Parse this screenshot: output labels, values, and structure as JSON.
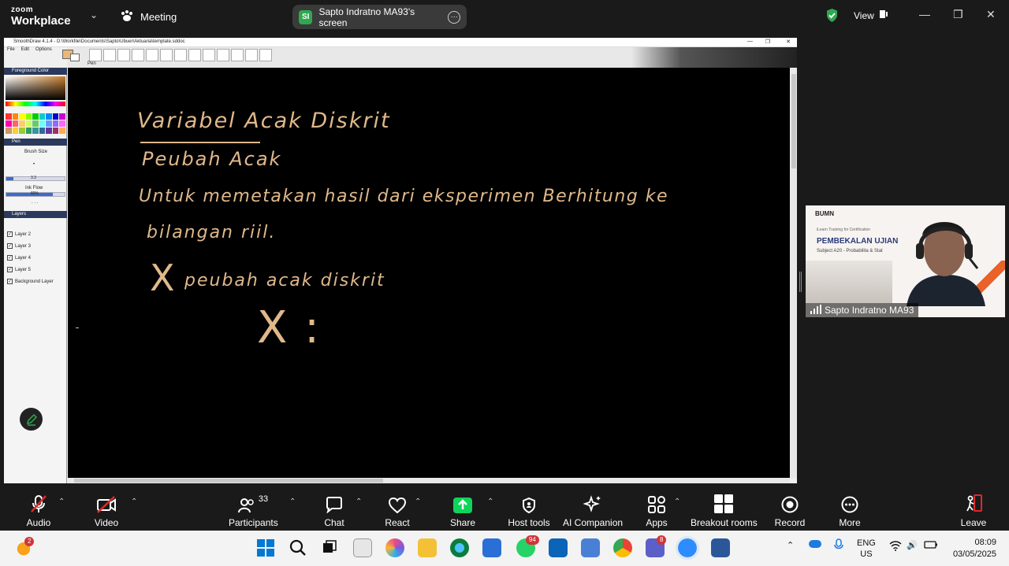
{
  "topbar": {
    "logo_top": "zoom",
    "logo_bottom": "Workplace",
    "meeting_label": "Meeting",
    "share_initials": "SI",
    "share_label": "Sapto Indratno MA93's screen",
    "view_label": "View"
  },
  "smoothdraw": {
    "title": "SmoothDraw 4.1.4 - D:\\Workfile\\Documents\\Sapto\\Ubuer\\Aktuaria\\template.sddoc",
    "menu": [
      "File",
      "Edit",
      "Options"
    ],
    "tool_label": "Pen",
    "panel_foreground": "Foreground Color",
    "panel_pen": "Pen",
    "brush_size_label": "Brush Size",
    "brush_size_value": "3.3",
    "brush_size_fraction": 0.12,
    "ink_flow_label": "Ink Flow",
    "ink_flow_value": "80%",
    "ink_flow_fraction": 0.8,
    "panel_layers": "Layers",
    "layers": [
      "Layer 2",
      "Layer 3",
      "Layer 4",
      "Layer 5",
      "Background Layer"
    ]
  },
  "handwriting": {
    "title": "Variabel Acak Diskrit",
    "subtitle": "Peubah Acak",
    "line1": "Untuk memetakan hasil dari eksperimen Berhitung ke",
    "line2": "bilangan riil.",
    "x_label": "X",
    "x_text": "peubah acak diskrit",
    "x2": "X :"
  },
  "video": {
    "brand": "BUMN",
    "small": "iLearn Training for Certification",
    "title": "PEMBEKALAN UJIAN",
    "subtitle": "Subject A20 - Probabilita & Stat",
    "name": "Sapto Indratno MA93"
  },
  "controls": {
    "audio": "Audio",
    "video": "Video",
    "participants": "Participants",
    "participants_count": "33",
    "chat": "Chat",
    "react": "React",
    "share": "Share",
    "host_tools": "Host tools",
    "ai_companion": "AI Companion",
    "apps": "Apps",
    "breakout": "Breakout rooms",
    "record": "Record",
    "more": "More",
    "leave": "Leave"
  },
  "taskbar": {
    "weather_badge": "2",
    "whatsapp_badge": "94",
    "teams_badge": "8",
    "lang1": "ENG",
    "lang2": "US",
    "time": "08:09",
    "date": "03/05/2025"
  },
  "colors": {
    "accent_green": "#2fa84f",
    "ink": "#e0b88a",
    "share_green": "#0fd45a"
  }
}
